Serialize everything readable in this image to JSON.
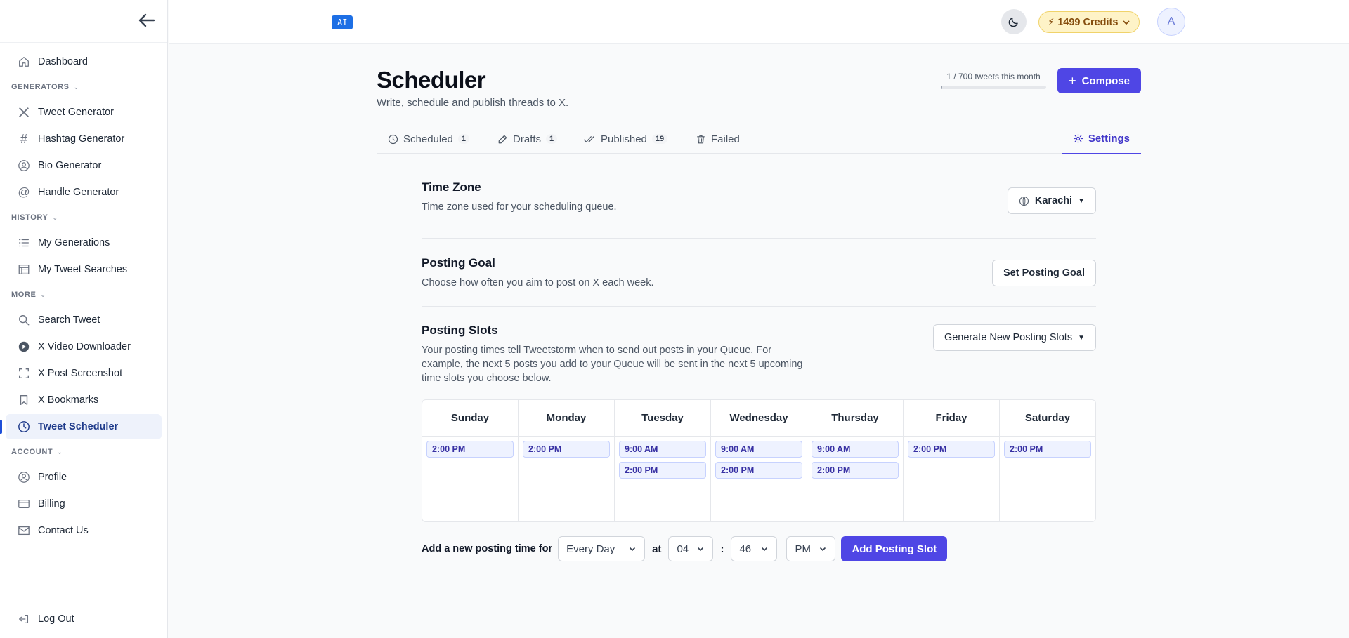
{
  "sidebar": {
    "dashboard": "Dashboard",
    "sections": {
      "generators": "GENERATORS",
      "history": "HISTORY",
      "more": "MORE",
      "account": "ACCOUNT"
    },
    "generators": [
      "Tweet Generator",
      "Hashtag Generator",
      "Bio Generator",
      "Handle Generator"
    ],
    "history": [
      "My Generations",
      "My Tweet Searches"
    ],
    "more": [
      "Search Tweet",
      "X Video Downloader",
      "X Post Screenshot",
      "X Bookmarks",
      "Tweet Scheduler"
    ],
    "account": [
      "Profile",
      "Billing",
      "Contact Us"
    ],
    "logout": "Log Out",
    "active_item": "Tweet Scheduler"
  },
  "topbar": {
    "ai_badge": "AI",
    "credits": "⚡ 1499 Credits",
    "avatar_initial": "A"
  },
  "header": {
    "title": "Scheduler",
    "subtitle": "Write, schedule and publish threads to X.",
    "usage_text": "1 / 700 tweets this month",
    "usage_fraction": 0.0014,
    "compose_label": "Compose"
  },
  "tabs": {
    "scheduled": {
      "label": "Scheduled",
      "count": "1"
    },
    "drafts": {
      "label": "Drafts",
      "count": "1"
    },
    "published": {
      "label": "Published",
      "count": "19"
    },
    "failed": {
      "label": "Failed"
    },
    "settings": {
      "label": "Settings"
    }
  },
  "settings": {
    "timezone": {
      "title": "Time Zone",
      "desc": "Time zone used for your scheduling queue.",
      "value": "Karachi"
    },
    "goal": {
      "title": "Posting Goal",
      "desc": "Choose how often you aim to post on X each week.",
      "button": "Set Posting Goal"
    },
    "slots": {
      "title": "Posting Slots",
      "desc": "Your posting times tell Tweetstorm when to send out posts in your Queue. For example, the next 5 posts you add to your Queue will be sent in the next 5 upcoming time slots you choose below.",
      "button": "Generate New Posting Slots"
    }
  },
  "week": [
    {
      "day": "Sunday",
      "slots": [
        "2:00 PM"
      ]
    },
    {
      "day": "Monday",
      "slots": [
        "2:00 PM"
      ]
    },
    {
      "day": "Tuesday",
      "slots": [
        "9:00 AM",
        "2:00 PM"
      ]
    },
    {
      "day": "Wednesday",
      "slots": [
        "9:00 AM",
        "2:00 PM"
      ]
    },
    {
      "day": "Thursday",
      "slots": [
        "9:00 AM",
        "2:00 PM"
      ]
    },
    {
      "day": "Friday",
      "slots": [
        "2:00 PM"
      ]
    },
    {
      "day": "Saturday",
      "slots": [
        "2:00 PM"
      ]
    }
  ],
  "add_slot": {
    "label": "Add a new posting time for",
    "day_value": "Every Day",
    "at": "at",
    "hour": "04",
    "colon": ":",
    "minute": "46",
    "ampm": "PM",
    "button": "Add Posting Slot"
  },
  "colors": {
    "accent": "#4f46e5",
    "credits_bg": "#fef3c7",
    "ai_badge": "#1d6fe5"
  }
}
